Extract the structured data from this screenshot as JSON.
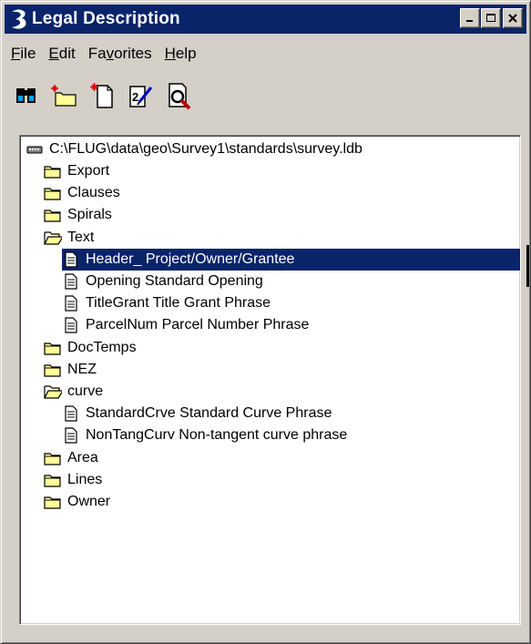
{
  "window": {
    "title": "Legal Description"
  },
  "menu": [
    {
      "label": "File",
      "key": "F",
      "rest": "ile"
    },
    {
      "label": "Edit",
      "key": "E",
      "rest": "dit"
    },
    {
      "label": "Favorites",
      "pre": "Fa",
      "key": "v",
      "rest": "orites"
    },
    {
      "label": "Help",
      "key": "H",
      "rest": "elp"
    }
  ],
  "toolbar": [
    {
      "name": "find-icon"
    },
    {
      "name": "new-folder-icon"
    },
    {
      "name": "new-document-icon"
    },
    {
      "name": "edit-document-icon"
    },
    {
      "name": "preview-icon"
    }
  ],
  "tree": {
    "root": "C:\\FLUG\\data\\geo\\Survey1\\standards\\survey.ldb",
    "items": [
      {
        "label": "Export",
        "type": "folder",
        "level": 1
      },
      {
        "label": "Clauses",
        "type": "folder",
        "level": 1
      },
      {
        "label": "Spirals",
        "type": "folder",
        "level": 1
      },
      {
        "label": "Text",
        "type": "open-folder",
        "level": 1
      },
      {
        "label": "Header_ Project/Owner/Grantee",
        "type": "doc",
        "level": 2,
        "selected": true
      },
      {
        "label": "Opening Standard Opening",
        "type": "doc",
        "level": 2
      },
      {
        "label": "TitleGrant Title Grant Phrase",
        "type": "doc",
        "level": 2
      },
      {
        "label": "ParcelNum Parcel Number Phrase",
        "type": "doc",
        "level": 2
      },
      {
        "label": "DocTemps",
        "type": "folder",
        "level": 1
      },
      {
        "label": "NEZ",
        "type": "folder",
        "level": 1
      },
      {
        "label": "curve",
        "type": "open-folder",
        "level": 1
      },
      {
        "label": "StandardCrve Standard Curve Phrase",
        "type": "doc",
        "level": 2
      },
      {
        "label": "NonTangCurv Non-tangent curve phrase",
        "type": "doc",
        "level": 2
      },
      {
        "label": "Area",
        "type": "folder",
        "level": 1
      },
      {
        "label": "Lines",
        "type": "folder",
        "level": 1
      },
      {
        "label": "Owner",
        "type": "folder",
        "level": 1
      }
    ]
  },
  "colors": {
    "titlebar": "#0a246a",
    "selection": "#0a246a",
    "face": "#d4d0c8",
    "folder": "#ffff99"
  }
}
